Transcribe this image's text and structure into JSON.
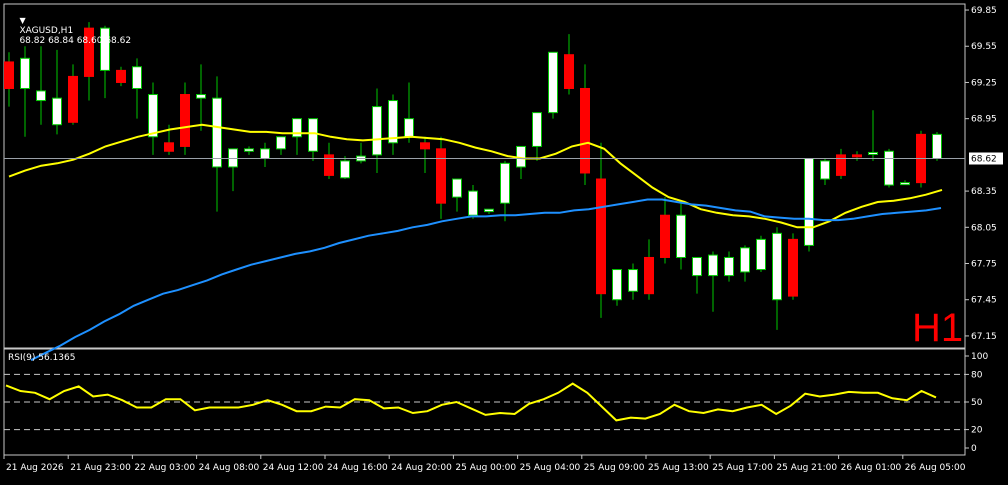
{
  "header": {
    "symbol": "XAGUSD,H1",
    "ohlc": "68.82 68.84 68.60 68.62",
    "timeframe_mark": "H1",
    "rsi_label": "RSI(9) 56.1365"
  },
  "colors": {
    "background": "#000000",
    "frame": "#c8c8c8",
    "bull": "#ffffff",
    "bear": "#ff0000",
    "wick": "#00c800",
    "ma_fast": "#ffff00",
    "ma_slow": "#1e90ff",
    "rsi": "#ffff00",
    "bid_line": "#9aa0a8",
    "text": "#ffffff",
    "timeframe_mark": "#ff0000"
  },
  "chart_data": [
    {
      "type": "candlestick",
      "instrument": "XAGUSD",
      "timeframe": "H1",
      "ylim": [
        67.05,
        69.9
      ],
      "price_ticks": [
        "69.85",
        "69.55",
        "69.25",
        "68.95",
        "68.35",
        "68.05",
        "67.75",
        "67.45",
        "67.15"
      ],
      "current_price": "68.62",
      "x_labels": [
        "21 Aug 2026",
        "21 Aug 23:00",
        "22 Aug 03:00",
        "24 Aug 08:00",
        "24 Aug 12:00",
        "24 Aug 16:00",
        "24 Aug 20:00",
        "25 Aug 00:00",
        "25 Aug 04:00",
        "25 Aug 09:00",
        "25 Aug 13:00",
        "25 Aug 17:00",
        "25 Aug 21:00",
        "26 Aug 01:00",
        "26 Aug 05:00"
      ],
      "candles": [
        {
          "o": 69.42,
          "h": 69.5,
          "l": 69.05,
          "c": 69.2
        },
        {
          "o": 69.2,
          "h": 69.55,
          "l": 68.8,
          "c": 69.45
        },
        {
          "o": 69.1,
          "h": 69.55,
          "l": 68.9,
          "c": 69.18
        },
        {
          "o": 68.9,
          "h": 69.52,
          "l": 68.82,
          "c": 69.12
        },
        {
          "o": 69.3,
          "h": 69.4,
          "l": 68.9,
          "c": 68.92
        },
        {
          "o": 69.7,
          "h": 69.75,
          "l": 69.1,
          "c": 69.3
        },
        {
          "o": 69.35,
          "h": 69.72,
          "l": 69.12,
          "c": 69.7
        },
        {
          "o": 69.35,
          "h": 69.38,
          "l": 69.22,
          "c": 69.25
        },
        {
          "o": 69.2,
          "h": 69.45,
          "l": 68.95,
          "c": 69.38
        },
        {
          "o": 68.8,
          "h": 69.25,
          "l": 68.65,
          "c": 69.15
        },
        {
          "o": 68.75,
          "h": 68.9,
          "l": 68.65,
          "c": 68.68
        },
        {
          "o": 69.15,
          "h": 69.25,
          "l": 68.65,
          "c": 68.72
        },
        {
          "o": 69.12,
          "h": 69.4,
          "l": 68.85,
          "c": 69.15
        },
        {
          "o": 68.55,
          "h": 69.3,
          "l": 68.18,
          "c": 69.12
        },
        {
          "o": 68.55,
          "h": 68.7,
          "l": 68.35,
          "c": 68.7
        },
        {
          "o": 68.68,
          "h": 68.72,
          "l": 68.65,
          "c": 68.7
        },
        {
          "o": 68.62,
          "h": 68.75,
          "l": 68.55,
          "c": 68.7
        },
        {
          "o": 68.7,
          "h": 68.8,
          "l": 68.65,
          "c": 68.8
        },
        {
          "o": 68.8,
          "h": 68.95,
          "l": 68.65,
          "c": 68.95
        },
        {
          "o": 68.68,
          "h": 68.95,
          "l": 68.6,
          "c": 68.95
        },
        {
          "o": 68.65,
          "h": 68.75,
          "l": 68.45,
          "c": 68.48
        },
        {
          "o": 68.46,
          "h": 68.64,
          "l": 68.45,
          "c": 68.6
        },
        {
          "o": 68.6,
          "h": 68.75,
          "l": 68.58,
          "c": 68.64
        },
        {
          "o": 68.65,
          "h": 69.2,
          "l": 68.5,
          "c": 69.05
        },
        {
          "o": 68.75,
          "h": 69.15,
          "l": 68.65,
          "c": 69.1
        },
        {
          "o": 68.8,
          "h": 69.25,
          "l": 68.75,
          "c": 68.95
        },
        {
          "o": 68.75,
          "h": 68.8,
          "l": 68.5,
          "c": 68.7
        },
        {
          "o": 68.7,
          "h": 68.8,
          "l": 68.12,
          "c": 68.25
        },
        {
          "o": 68.3,
          "h": 68.42,
          "l": 68.18,
          "c": 68.45
        },
        {
          "o": 68.15,
          "h": 68.4,
          "l": 68.12,
          "c": 68.35
        },
        {
          "o": 68.18,
          "h": 68.2,
          "l": 68.16,
          "c": 68.2
        },
        {
          "o": 68.25,
          "h": 68.6,
          "l": 68.1,
          "c": 68.58
        },
        {
          "o": 68.55,
          "h": 68.72,
          "l": 68.45,
          "c": 68.72
        },
        {
          "o": 68.72,
          "h": 69.0,
          "l": 68.6,
          "c": 69.0
        },
        {
          "o": 69.0,
          "h": 69.5,
          "l": 68.95,
          "c": 69.5
        },
        {
          "o": 69.48,
          "h": 69.65,
          "l": 69.15,
          "c": 69.2
        },
        {
          "o": 69.2,
          "h": 69.4,
          "l": 68.4,
          "c": 68.5
        },
        {
          "o": 68.45,
          "h": 68.75,
          "l": 67.3,
          "c": 67.5
        },
        {
          "o": 67.45,
          "h": 67.7,
          "l": 67.4,
          "c": 67.7
        },
        {
          "o": 67.52,
          "h": 67.75,
          "l": 67.45,
          "c": 67.7
        },
        {
          "o": 67.8,
          "h": 67.95,
          "l": 67.45,
          "c": 67.5
        },
        {
          "o": 68.15,
          "h": 68.3,
          "l": 67.75,
          "c": 67.8
        },
        {
          "o": 67.8,
          "h": 68.25,
          "l": 67.7,
          "c": 68.15
        },
        {
          "o": 67.65,
          "h": 67.8,
          "l": 67.5,
          "c": 67.8
        },
        {
          "o": 67.65,
          "h": 67.85,
          "l": 67.35,
          "c": 67.82
        },
        {
          "o": 67.65,
          "h": 67.85,
          "l": 67.6,
          "c": 67.8
        },
        {
          "o": 67.68,
          "h": 67.9,
          "l": 67.6,
          "c": 67.88
        },
        {
          "o": 67.7,
          "h": 67.98,
          "l": 67.68,
          "c": 67.95
        },
        {
          "o": 67.45,
          "h": 68.05,
          "l": 67.2,
          "c": 68.0
        },
        {
          "o": 67.95,
          "h": 68.0,
          "l": 67.45,
          "c": 67.48
        },
        {
          "o": 67.9,
          "h": 68.62,
          "l": 67.85,
          "c": 68.62
        },
        {
          "o": 68.45,
          "h": 68.62,
          "l": 68.4,
          "c": 68.6
        },
        {
          "o": 68.65,
          "h": 68.7,
          "l": 68.45,
          "c": 68.48
        },
        {
          "o": 68.65,
          "h": 68.68,
          "l": 68.6,
          "c": 68.64
        },
        {
          "o": 68.66,
          "h": 69.02,
          "l": 68.6,
          "c": 68.67
        },
        {
          "o": 68.4,
          "h": 68.7,
          "l": 68.38,
          "c": 68.68
        },
        {
          "o": 68.42,
          "h": 68.44,
          "l": 68.4,
          "c": 68.42
        },
        {
          "o": 68.82,
          "h": 68.85,
          "l": 68.38,
          "c": 68.42
        },
        {
          "o": 68.62,
          "h": 68.84,
          "l": 68.6,
          "c": 68.82
        }
      ],
      "ma_fast": [
        68.47,
        68.52,
        68.56,
        68.58,
        68.61,
        68.66,
        68.72,
        68.76,
        68.8,
        68.83,
        68.86,
        68.88,
        68.9,
        68.88,
        68.86,
        68.84,
        68.84,
        68.83,
        68.83,
        68.83,
        68.8,
        68.78,
        68.77,
        68.78,
        68.79,
        68.8,
        68.79,
        68.78,
        68.75,
        68.71,
        68.68,
        68.64,
        68.62,
        68.62,
        68.66,
        68.72,
        68.75,
        68.7,
        68.58,
        68.48,
        68.38,
        68.3,
        68.26,
        68.2,
        68.17,
        68.15,
        68.14,
        68.12,
        68.09,
        68.05,
        68.05,
        68.1,
        68.17,
        68.22,
        68.26,
        68.27,
        68.29,
        68.32,
        68.36
      ],
      "ma_slow": [
        66.95,
        67.01,
        67.07,
        67.14,
        67.2,
        67.27,
        67.33,
        67.4,
        67.45,
        67.5,
        67.53,
        67.57,
        67.61,
        67.66,
        67.7,
        67.74,
        67.77,
        67.8,
        67.83,
        67.85,
        67.88,
        67.92,
        67.95,
        67.98,
        68.0,
        68.02,
        68.05,
        68.07,
        68.1,
        68.12,
        68.14,
        68.14,
        68.15,
        68.15,
        68.16,
        68.17,
        68.17,
        68.19,
        68.2,
        68.22,
        68.24,
        68.26,
        68.28,
        68.28,
        68.26,
        68.24,
        68.23,
        68.21,
        68.19,
        68.18,
        68.14,
        68.13,
        68.12,
        68.12,
        68.11,
        68.11,
        68.12,
        68.14,
        68.16,
        68.17,
        68.18,
        68.19,
        68.21
      ]
    },
    {
      "type": "line",
      "indicator": "RSI(9)",
      "ylim": [
        0,
        100
      ],
      "levels": [
        80,
        50,
        20
      ],
      "y_ticks": [
        "100",
        "80",
        "50",
        "20",
        "0"
      ],
      "values": [
        68,
        62,
        60,
        53,
        62,
        67,
        56,
        58,
        52,
        44,
        44,
        53,
        53,
        41,
        44,
        44,
        44,
        47,
        52,
        47,
        40,
        40,
        45,
        44,
        53,
        52,
        43,
        44,
        38,
        40,
        47,
        50,
        43,
        36,
        38,
        37,
        48,
        53,
        60,
        70,
        60,
        45,
        30,
        33,
        32,
        37,
        47,
        40,
        38,
        42,
        40,
        44,
        47,
        37,
        46,
        59,
        56,
        58,
        61,
        60,
        60,
        54,
        52,
        62,
        55
      ]
    }
  ]
}
